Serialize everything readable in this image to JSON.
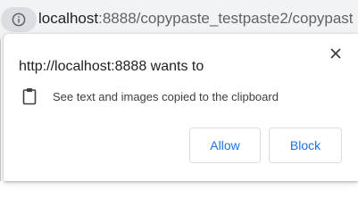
{
  "omnibox": {
    "url_host": "localhost",
    "url_rest": ":8888/copypaste_testpaste2/copypast"
  },
  "dialog": {
    "title": "http://localhost:8888 wants to",
    "permission_text": "See text and images copied to the clipboard",
    "allow_label": "Allow",
    "block_label": "Block",
    "close_icon": "close-icon",
    "permission_icon": "clipboard-icon"
  },
  "colors": {
    "accent": "#1a73e8",
    "button_border": "#dadce0",
    "text_primary": "#202124",
    "text_secondary": "#5f6368"
  }
}
